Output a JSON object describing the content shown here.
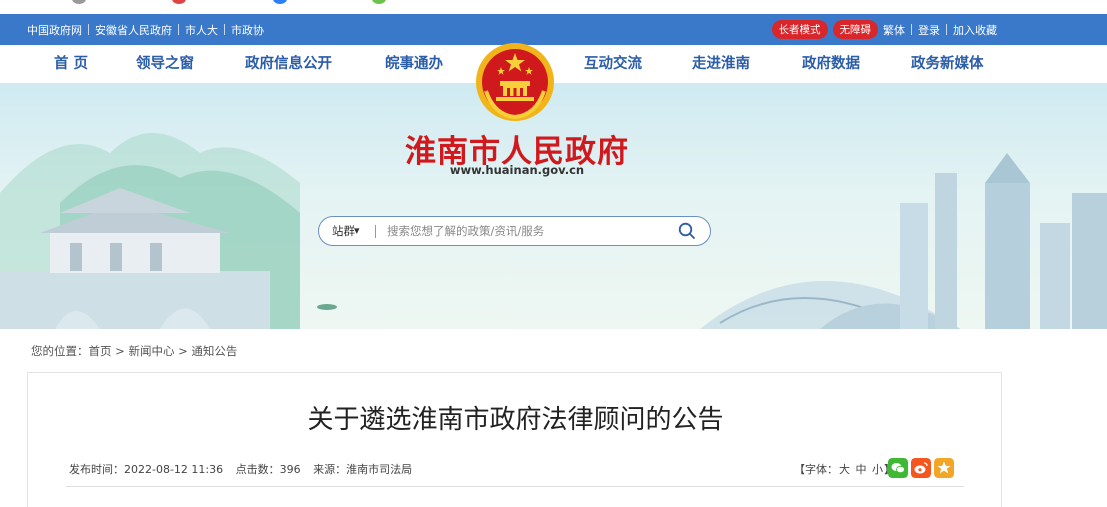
{
  "top_links": [
    "中国政府网",
    "安徽省人民政府",
    "市人大",
    "市政协"
  ],
  "top_right": {
    "elder_mode": "长者模式",
    "accessibility": "无障碍",
    "traditional": "繁体",
    "login": "登录",
    "favorite": "加入收藏"
  },
  "nav": {
    "items": [
      "首 页",
      "领导之窗",
      "政府信息公开",
      "皖事通办",
      "互动交流",
      "走进淮南",
      "政府数据",
      "政务新媒体"
    ]
  },
  "banner": {
    "title": "淮南市人民政府",
    "url": "www.huainan.gov.cn"
  },
  "search": {
    "scope": "站群",
    "placeholder": "搜索您想了解的政策/资讯/服务"
  },
  "breadcrumb": {
    "prefix": "您的位置：",
    "items": [
      "首页",
      "新闻中心",
      "通知公告"
    ],
    "separator": ">"
  },
  "article": {
    "title": "关于遴选淮南市政府法律顾问的公告",
    "publish_time": "发布时间：2022-08-12 11:36",
    "views": "点击数：396",
    "source": "来源：淮南市司法局"
  },
  "font_size": {
    "open": "【字体：",
    "large": "大",
    "medium": "中",
    "small": "小",
    "close": "】"
  },
  "colors": {
    "topbar": "#3a78c9",
    "nav_text": "#2b5da8",
    "title_red": "#d0191d",
    "pill_red": "#d8262b"
  },
  "share_icons": [
    "wechat-icon",
    "weibo-icon",
    "favorite-star-icon"
  ]
}
